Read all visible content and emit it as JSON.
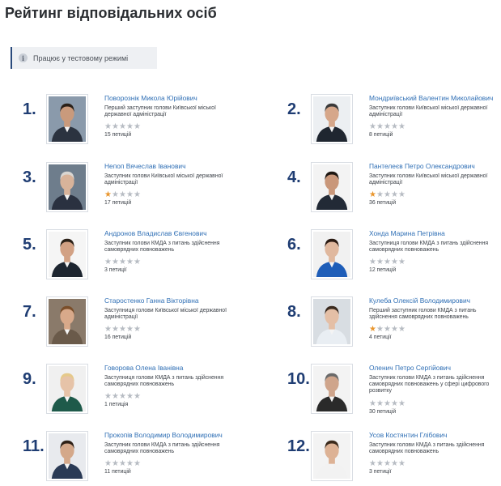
{
  "title": "Рейтинг відповідальних осіб",
  "notice": {
    "icon": "info-icon",
    "glyph": "i",
    "text": "Працює у тестовому режимі"
  },
  "accent_color": "#1f3d73",
  "link_color": "#2f6fb5",
  "star_color": "#e9962e",
  "officials": [
    {
      "rank": "1.",
      "name": "Поворознік Микола Юрійович",
      "position": "Перший заступник голови Київської міської державної адміністрації",
      "rating": 0,
      "petitions": "15 петицій"
    },
    {
      "rank": "2.",
      "name": "Мондриївський Валентин Миколайович",
      "position": "Заступник голови Київської міської державної адміністрації",
      "rating": 0,
      "petitions": "8 петицій"
    },
    {
      "rank": "3.",
      "name": "Непоп Вячеслав Іванович",
      "position": "Заступник голови Київської міської державної адміністрації",
      "rating": 1,
      "petitions": "17 петицій"
    },
    {
      "rank": "4.",
      "name": "Пантелеєв Петро Олександрович",
      "position": "Заступник голови Київської міської державної адміністрації",
      "rating": 1,
      "petitions": "36 петицій"
    },
    {
      "rank": "5.",
      "name": "Андронов Владислав Євгенович",
      "position": "Заступник голови КМДА з питань здійснення самоврядних повноважень",
      "rating": 0,
      "petitions": "3 петиції"
    },
    {
      "rank": "6.",
      "name": "Хонда Марина Петрівна",
      "position": "Заступниця голови КМДА з питань здійснення самоврядних повноважень",
      "rating": 0,
      "petitions": "12 петицій"
    },
    {
      "rank": "7.",
      "name": "Старостенко Ганна Вікторівна",
      "position": "Заступниця голови Київської міської державної адміністрації",
      "rating": 0,
      "petitions": "16 петицій"
    },
    {
      "rank": "8.",
      "name": "Кулеба Олексій Володимирович",
      "position": "Перший заступник голови КМДА з питань здійснення самоврядних повноважень",
      "rating": 1,
      "petitions": "4 петиції"
    },
    {
      "rank": "9.",
      "name": "Говорова Олена Іванівна",
      "position": "Заступниця голови КМДА з питань здійснення самоврядних повноважень",
      "rating": 0,
      "petitions": "1 петиція"
    },
    {
      "rank": "10.",
      "name": "Оленич Петро Сергійович",
      "position": "Заступник голови КМДА з питань здійснення самоврядних повноважень у сфері цифрового розвитку",
      "rating": 0,
      "petitions": "30 петицій"
    },
    {
      "rank": "11.",
      "name": "Прокопів Володимир Володимирович",
      "position": "Заступник голови КМДА з питань здійснення самоврядних повноважень",
      "rating": 0,
      "petitions": "11 петицій"
    },
    {
      "rank": "12.",
      "name": "Усов Костянтин Глібович",
      "position": "Заступник голови КМДА з питань здійснення самоврядних повноважень",
      "rating": 0,
      "petitions": "3 петиції"
    }
  ]
}
